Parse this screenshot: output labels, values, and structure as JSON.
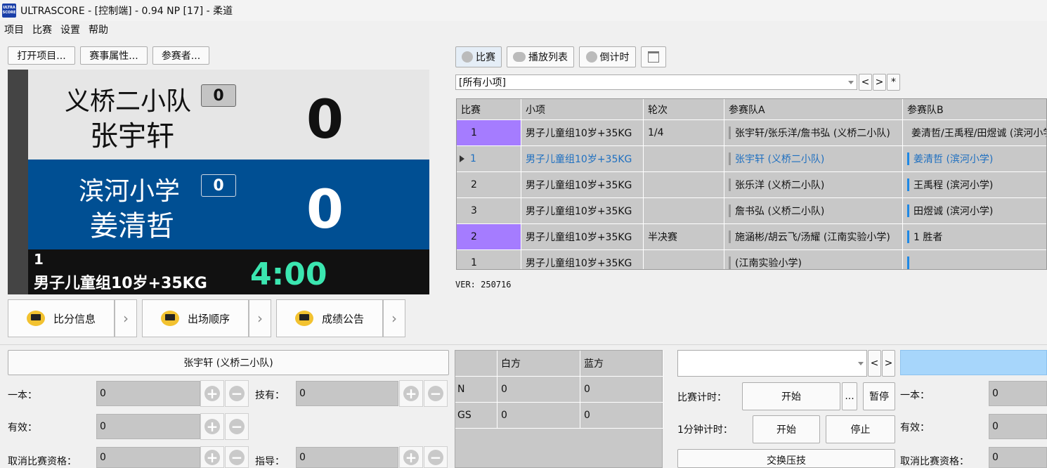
{
  "window": {
    "logo_text": "ULTRA SCORE",
    "title": "ULTRASCORE - [控制端] - 0.94 NP [17] - 柔道"
  },
  "menu": [
    "项目",
    "比赛",
    "设置",
    "帮助"
  ],
  "toolbar_left": {
    "open_project": "打开项目...",
    "event_props": "赛事属性...",
    "participants": "参赛者..."
  },
  "scoreboard": {
    "white": {
      "team": "义桥二小队",
      "player": "张宇轩",
      "penalty": "0",
      "score": "0"
    },
    "blue": {
      "team": "滨河小学",
      "player": "姜清哲",
      "penalty": "0",
      "score": "0"
    },
    "match_no": "1",
    "category": "男子儿童组10岁+35KG",
    "timer": "4:00"
  },
  "display_buttons": {
    "score_info": "比分信息",
    "entry_order": "出场顺序",
    "results": "成绩公告",
    "arrow": "›"
  },
  "right_tabs": {
    "match": "比赛",
    "playlist": "播放列表",
    "countdown": "倒计时"
  },
  "filter": {
    "value": "[所有小项]",
    "prev": "<",
    "next": ">",
    "all": "*"
  },
  "grid": {
    "headers": [
      "比赛",
      "小项",
      "轮次",
      "参赛队A",
      "参赛队B"
    ],
    "rows": [
      {
        "no": "1",
        "item": "男子儿童组10岁+35KG",
        "round": "1/4",
        "a": "张宇轩/张乐洋/詹书弘 (义桥二小队)",
        "b": "姜清哲/王禹程/田煜诚 (滨河小学)"
      },
      {
        "no": "1",
        "item": "男子儿童组10岁+35KG",
        "round": "",
        "a": "张宇轩 (义桥二小队)",
        "b": "姜清哲 (滨河小学)"
      },
      {
        "no": "2",
        "item": "男子儿童组10岁+35KG",
        "round": "",
        "a": "张乐洋 (义桥二小队)",
        "b": "王禹程 (滨河小学)"
      },
      {
        "no": "3",
        "item": "男子儿童组10岁+35KG",
        "round": "",
        "a": "詹书弘 (义桥二小队)",
        "b": "田煜诚 (滨河小学)"
      },
      {
        "no": "2",
        "item": "男子儿童组10岁+35KG",
        "round": "半决赛",
        "a": "施涵彬/胡云飞/汤耀 (江南实验小学)",
        "b": "1 胜者"
      },
      {
        "no": "1",
        "item": "男子儿童组10岁+35KG",
        "round": "",
        "a": " (江南实验小学)",
        "b": ""
      }
    ]
  },
  "version": "VER: 250716",
  "left_panel": {
    "player_header": "张宇轩 (义桥二小队)",
    "ippon_label": "一本：",
    "ippon_value": "0",
    "waza_label": "技有：",
    "waza_value": "0",
    "yuko_label": "有效：",
    "yuko_value": "0",
    "disq_label": "取消比赛资格：",
    "disq_value": "0",
    "shido_label": "指导：",
    "shido_value": "0"
  },
  "stats": {
    "headers": [
      "",
      "白方",
      "蓝方"
    ],
    "rows": [
      {
        "label": "N",
        "white": "0",
        "blue": "0"
      },
      {
        "label": "GS",
        "white": "0",
        "blue": "0"
      }
    ]
  },
  "controls": {
    "match_timer_label": "比赛计时：",
    "start": "开始",
    "more": "...",
    "pause": "暂停",
    "minute_timer_label": "1分钟计时：",
    "start2": "开始",
    "stop": "停止",
    "swap": "交换压技",
    "prev": "<",
    "next": ">"
  },
  "right_panel": {
    "ippon_label": "一本：",
    "ippon_value": "0",
    "yuko_label": "有效：",
    "yuko_value": "0",
    "disq_label": "取消比赛资格：",
    "disq_value": "0"
  },
  "colors": {
    "blue_panel": "#004f93",
    "timer_green": "#3be6b0",
    "highlight_row": "#a57cff",
    "blue_bar": "#1e88e5",
    "light_blue": "#a7d6fb"
  }
}
